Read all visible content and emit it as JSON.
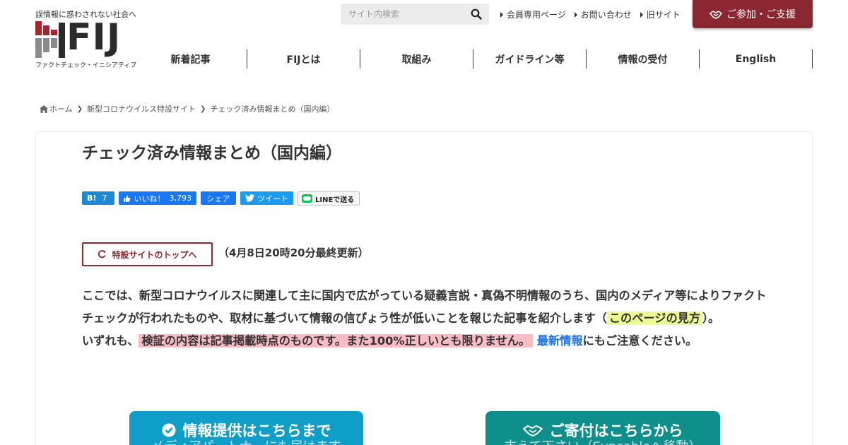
{
  "header": {
    "tagline": "誤情報に惑わされない社会へ",
    "logo_text": "FIJ",
    "logo_sub": "ファクトチェック・イニシアティブ",
    "search_placeholder": "サイト内検索",
    "top_links": [
      "会員専用ページ",
      "お問い合わせ",
      "旧サイト"
    ],
    "join_button": "ご参加・ご支援",
    "brand_color": "#8b2730"
  },
  "nav": {
    "items": [
      "新着記事",
      "FIJとは",
      "取組み",
      "ガイドライン等",
      "情報の受付",
      "English"
    ]
  },
  "breadcrumb": {
    "home": "ホーム",
    "items": [
      "新型コロナウイルス特設サイト",
      "チェック済み情報まとめ（国内編）"
    ]
  },
  "article": {
    "title": "チェック済み情報まとめ（国内編）",
    "share": {
      "hatena_label": "B!",
      "hatena_count": "7",
      "like_label": "いいね！",
      "like_count": "3,793",
      "fb_share": "シェア",
      "tweet": "ツイート",
      "line": "LINEで送る"
    },
    "top_button": "特設サイトのトップへ",
    "updated": "（4月8日20時20分最終更新）",
    "para1_text": "ここでは、新型コロナウイルスに関連して主に国内で広がっている疑義言説・真偽不明情報のうち、国内のメディア等によりファクトチェックが行われたものや、取材に基づいて情報の信ぴょう性が低いことを報じた記事を紹介します（",
    "para1_link": "このページの見方",
    "para1_end": "）。",
    "para2_start": "いずれも、",
    "para2_warning": "検証の内容は記事掲載時点のものです。また100%正しいとも限りません。",
    "para2_link": "最新情報",
    "para2_end": "にもご注意ください。",
    "cta_info_title": "情報提供はこちらまで",
    "cta_info_sub": "メディアパートナーにも届けます",
    "cta_donate_title": "ご寄付はこちらから",
    "cta_donate_sub": "支えて下さい（Syncableへ移動）"
  },
  "colors": {
    "accent": "#8b2730",
    "highlight_yellow": "#ecfa94",
    "highlight_pink": "#f9bcc5",
    "link_blue": "#1a73e8",
    "cta_info": "#0e9ec8",
    "cta_donate": "#0f8f8c"
  },
  "icons": [
    "search-icon",
    "caret-right-icon",
    "handshake-icon",
    "home-icon",
    "chevron-right-icon",
    "thumbs-up-icon",
    "twitter-bird-icon",
    "line-icon",
    "refresh-icon",
    "check-circle-icon"
  ]
}
